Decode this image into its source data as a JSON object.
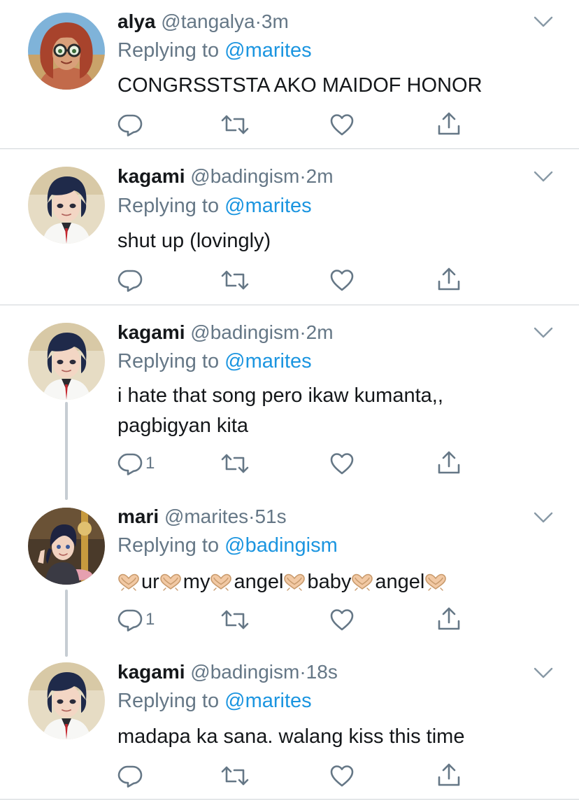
{
  "tweets": [
    {
      "display_name": "alya",
      "handle": "@tangalya",
      "separator": "·",
      "time": "3m",
      "reply_prefix": "Replying to",
      "reply_handle": "@marites",
      "text": "CONGRSSTSTA AKO MAIDOF HONOR",
      "reply_count": "",
      "avatar_icon": "avatar-redhead-glasses"
    },
    {
      "display_name": "kagami",
      "handle": "@badingism",
      "separator": "·",
      "time": "2m",
      "reply_prefix": "Replying to",
      "reply_handle": "@marites",
      "text": "shut up (lovingly)",
      "reply_count": "",
      "avatar_icon": "avatar-blue-bob-hair"
    },
    {
      "display_name": "kagami",
      "handle": "@badingism",
      "separator": "·",
      "time": "2m",
      "reply_prefix": "Replying to",
      "reply_handle": "@marites",
      "text_lines": [
        "i hate that song pero ikaw kumanta,,",
        "pagbigyan kita"
      ],
      "reply_count": "1",
      "avatar_icon": "avatar-blue-bob-hair"
    },
    {
      "display_name": "mari",
      "handle": "@marites",
      "separator": "·",
      "time": "51s",
      "reply_prefix": "Replying to",
      "reply_handle": "@badingism",
      "text_words": [
        "ur",
        "my",
        "angel",
        "baby",
        "angel"
      ],
      "emoji": "heart-hands",
      "reply_count": "1",
      "avatar_icon": "avatar-dark-hair-carousel"
    },
    {
      "display_name": "kagami",
      "handle": "@badingism",
      "separator": "·",
      "time": "18s",
      "reply_prefix": "Replying to",
      "reply_handle": "@marites",
      "text": "madapa ka sana. walang kiss this time",
      "reply_count": "",
      "avatar_icon": "avatar-blue-bob-hair"
    }
  ],
  "action_icons": [
    "reply-icon",
    "retweet-icon",
    "like-icon",
    "share-icon"
  ],
  "colors": {
    "text": "#14171a",
    "secondary": "#657786",
    "link": "#1b95e0",
    "divider": "#cfd4d8",
    "thread_line": "#c6cdd3"
  }
}
